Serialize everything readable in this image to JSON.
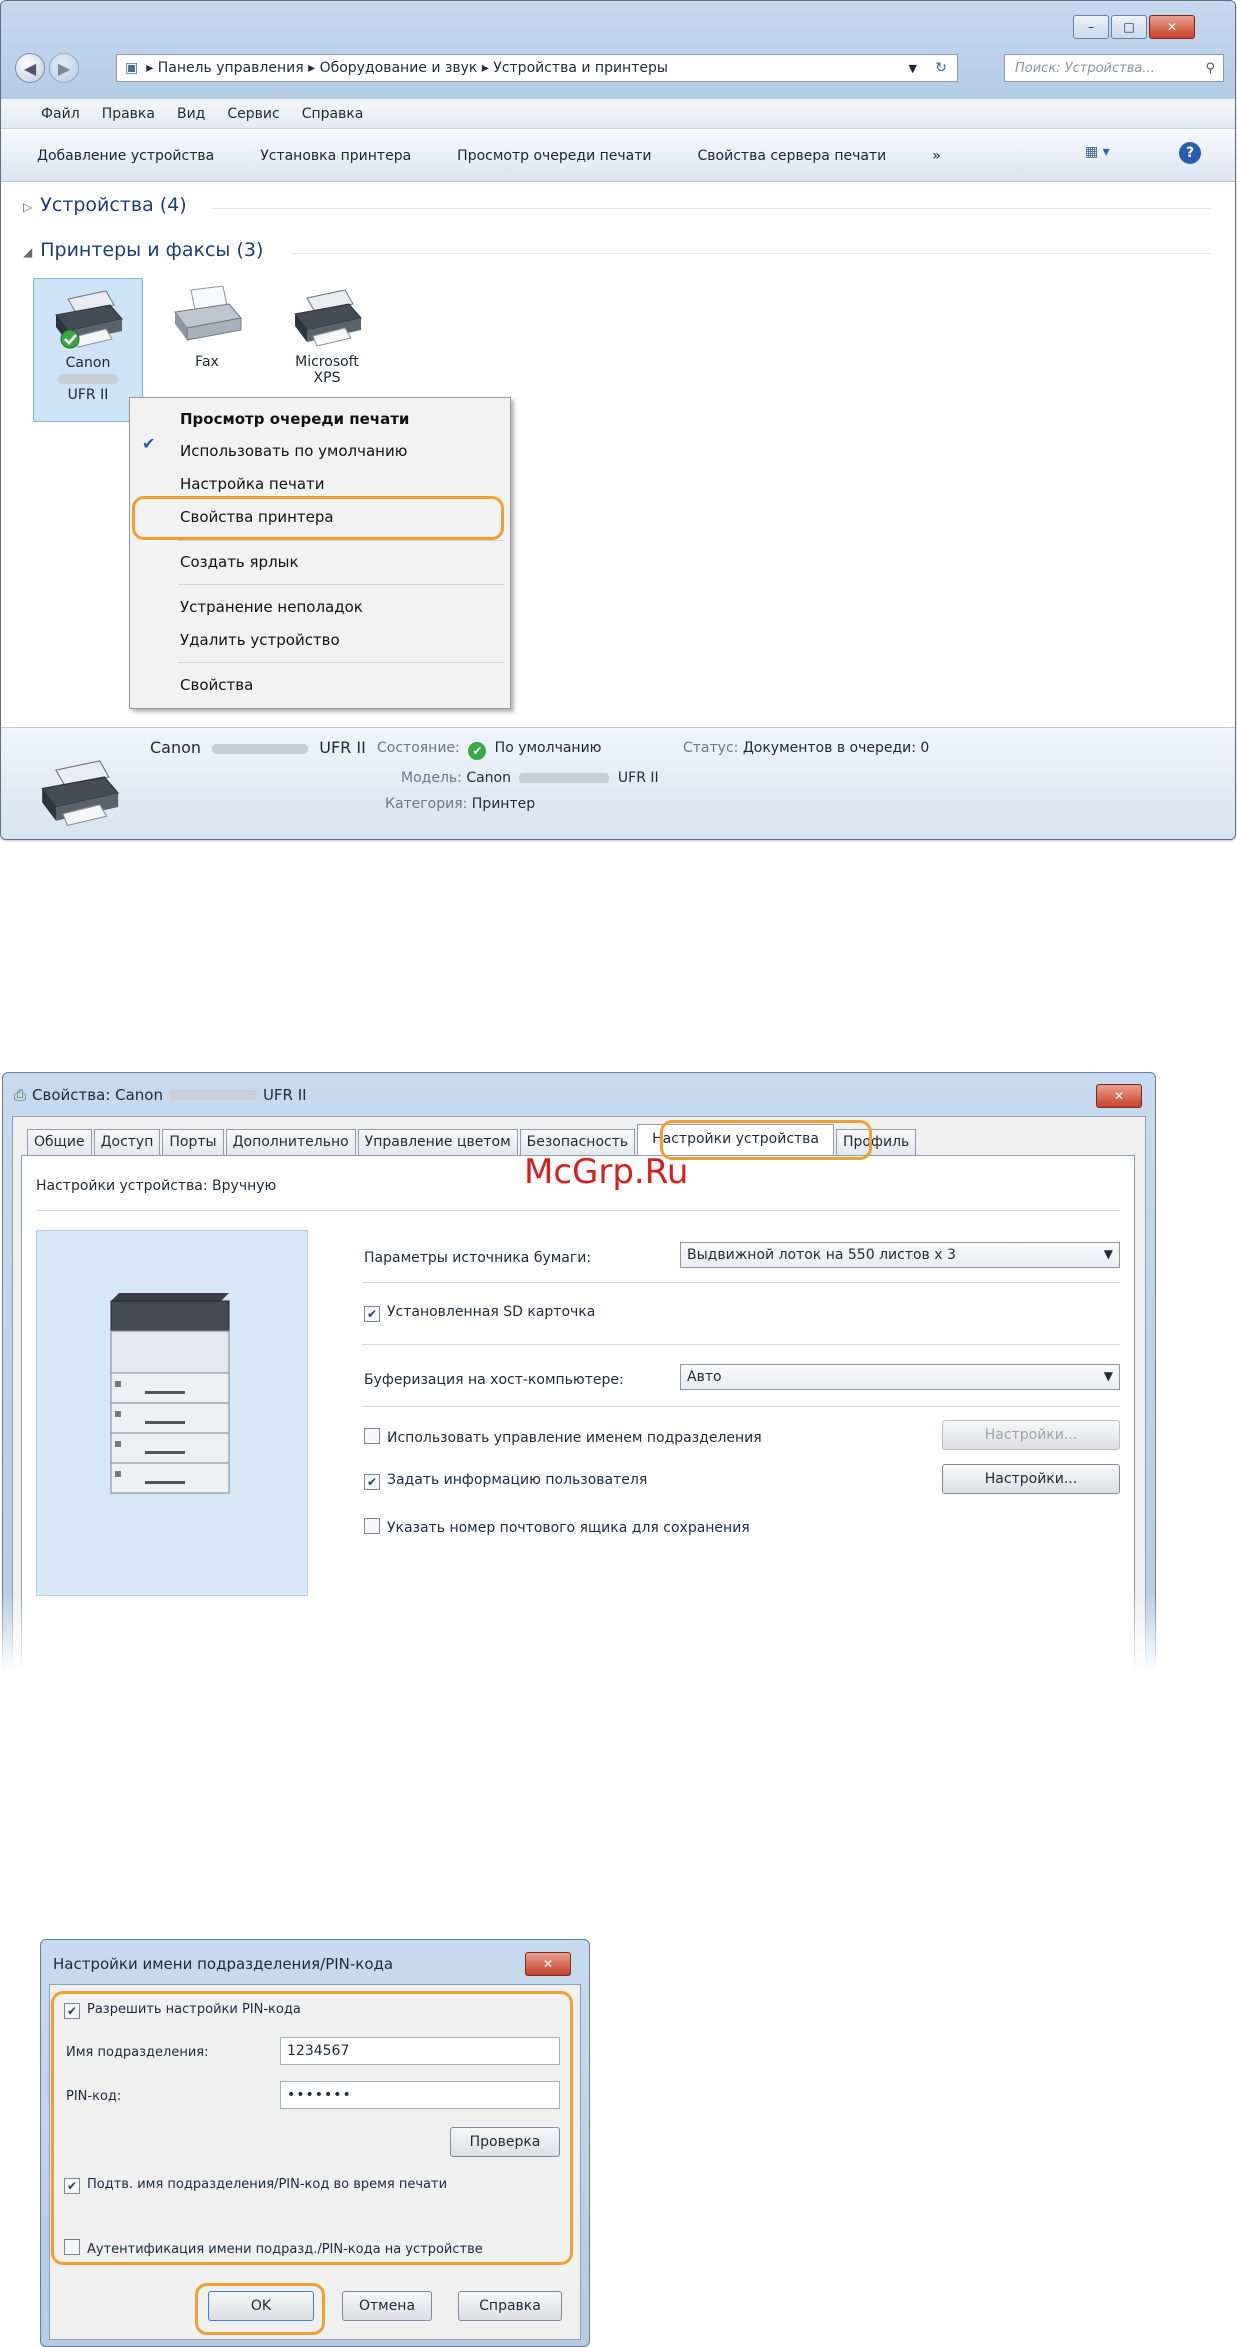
{
  "explorer": {
    "breadcrumb": [
      "Панель управления",
      "Оборудование и звук",
      "Устройства и принтеры"
    ],
    "search_placeholder": "Поиск: Устройства...",
    "menu": [
      "Файл",
      "Правка",
      "Вид",
      "Сервис",
      "Справка"
    ],
    "commands": [
      "Добавление устройства",
      "Установка принтера",
      "Просмотр очереди печати",
      "Свойства сервера печати",
      "»"
    ],
    "group_devices": "Устройства (4)",
    "group_printers": "Принтеры и факсы (3)",
    "devices": [
      {
        "label": "Canon",
        "sub": "UFR II"
      },
      {
        "label": "Fax",
        "sub": ""
      },
      {
        "label": "Microsoft",
        "sub": "XPS"
      }
    ],
    "context_menu": [
      "Просмотр очереди печати",
      "Использовать по умолчанию",
      "Настройка печати",
      "Свойства принтера",
      "Создать ярлык",
      "Устранение неполадок",
      "Удалить устройство",
      "Свойства"
    ],
    "status": {
      "name": "Canon",
      "driver": "UFR II",
      "state_label": "Состояние:",
      "state_value": "По умолчанию",
      "queue_label": "Статус:",
      "queue_value": "Документов в очереди: 0",
      "model_label": "Модель:",
      "model_value": "Canon",
      "model_driver": "UFR II",
      "category_label": "Категория:",
      "category_value": "Принтер"
    }
  },
  "props": {
    "title_prefix": "Свойства: Canon",
    "title_suffix": "UFR II",
    "tabs": [
      "Общие",
      "Доступ",
      "Порты",
      "Дополнительно",
      "Управление цветом",
      "Безопасность",
      "Настройки устройства",
      "Профиль"
    ],
    "mode_label": "Настройки устройства: Вручную",
    "paper_label": "Параметры источника бумаги:",
    "paper_value": "Выдвижной лоток на 550 листов x 3",
    "sd_label": "Установленная SD карточка",
    "spool_label": "Буферизация на хост-компьютере:",
    "spool_value": "Авто",
    "dept_label": "Использовать управление именем подразделения",
    "user_label": "Задать информацию пользователя",
    "mailbox_label": "Указать номер почтового ящика для сохранения",
    "settings_button": "Настройки..."
  },
  "watermark": "McGrp.Ru",
  "pin": {
    "title": "Настройки имени подразделения/PIN-кода",
    "allow_label": "Разрешить настройки PIN-кода",
    "dept_label": "Имя подразделения:",
    "dept_value": "1234567",
    "pin_label": "PIN-код:",
    "pin_value": "•••••••",
    "verify_button": "Проверка",
    "confirm_label": "Подтв. имя подразделения/PIN-код во время печати",
    "auth_label": "Аутентификация имени подразд./PIN-кода на устройстве",
    "ok": "OK",
    "cancel": "Отмена",
    "help": "Справка"
  },
  "colors": {
    "highlight": "#f0a030",
    "watermark": "#d71e1e"
  }
}
